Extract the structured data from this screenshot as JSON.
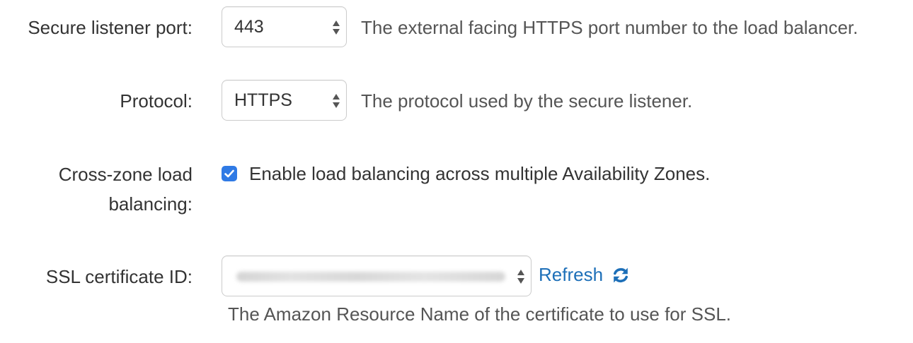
{
  "secure_listener_port": {
    "label": "Secure listener port:",
    "value": "443",
    "help": "The external facing HTTPS port number to the load balancer."
  },
  "protocol": {
    "label": "Protocol:",
    "value": "HTTPS",
    "help": "The protocol used by the secure listener."
  },
  "cross_zone": {
    "label_line1": "Cross-zone load",
    "label_line2": "balancing:",
    "checked": true,
    "checkbox_label": "Enable load balancing across multiple Availability Zones."
  },
  "ssl_certificate": {
    "label": "SSL certificate ID:",
    "value_redacted": true,
    "refresh_label": "Refresh",
    "refresh_icon": "refresh-icon",
    "help": "The Amazon Resource Name of the certificate to use for SSL."
  },
  "colors": {
    "link": "#1d6fb8",
    "checkbox": "#2f7ae5",
    "text": "#333333",
    "help_text": "#555555"
  }
}
